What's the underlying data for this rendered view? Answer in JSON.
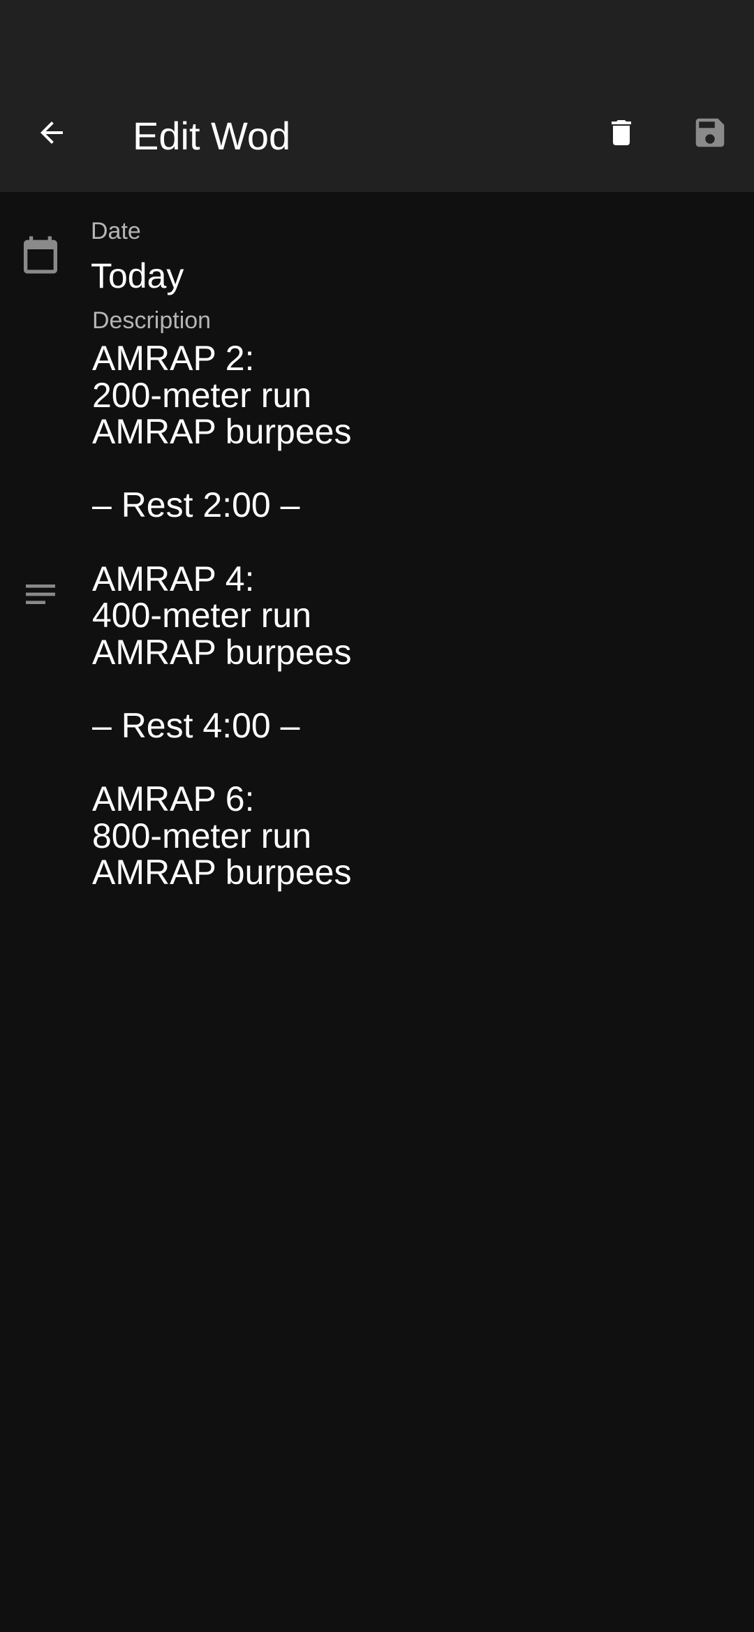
{
  "app_bar": {
    "title": "Edit Wod",
    "back_icon": "arrow-back-icon",
    "delete_icon": "trash-icon",
    "save_icon": "floppy-disk-icon"
  },
  "form": {
    "date": {
      "icon": "calendar-icon",
      "label": "Date",
      "value": "Today"
    },
    "description": {
      "icon": "notes-icon",
      "label": "Description",
      "value": "AMRAP 2:\n200-meter run\nAMRAP burpees\n\n– Rest 2:00 –\n\nAMRAP 4:\n400-meter run\nAMRAP burpees\n\n– Rest 4:00 –\n\nAMRAP 6:\n800-meter run\nAMRAP burpees"
    }
  },
  "colors": {
    "app_bar_bg": "#212121",
    "body_bg": "#101010",
    "label": "#b5b5b5",
    "icon_muted": "#8a8a8a",
    "save_disabled": "#8a8a8a"
  }
}
